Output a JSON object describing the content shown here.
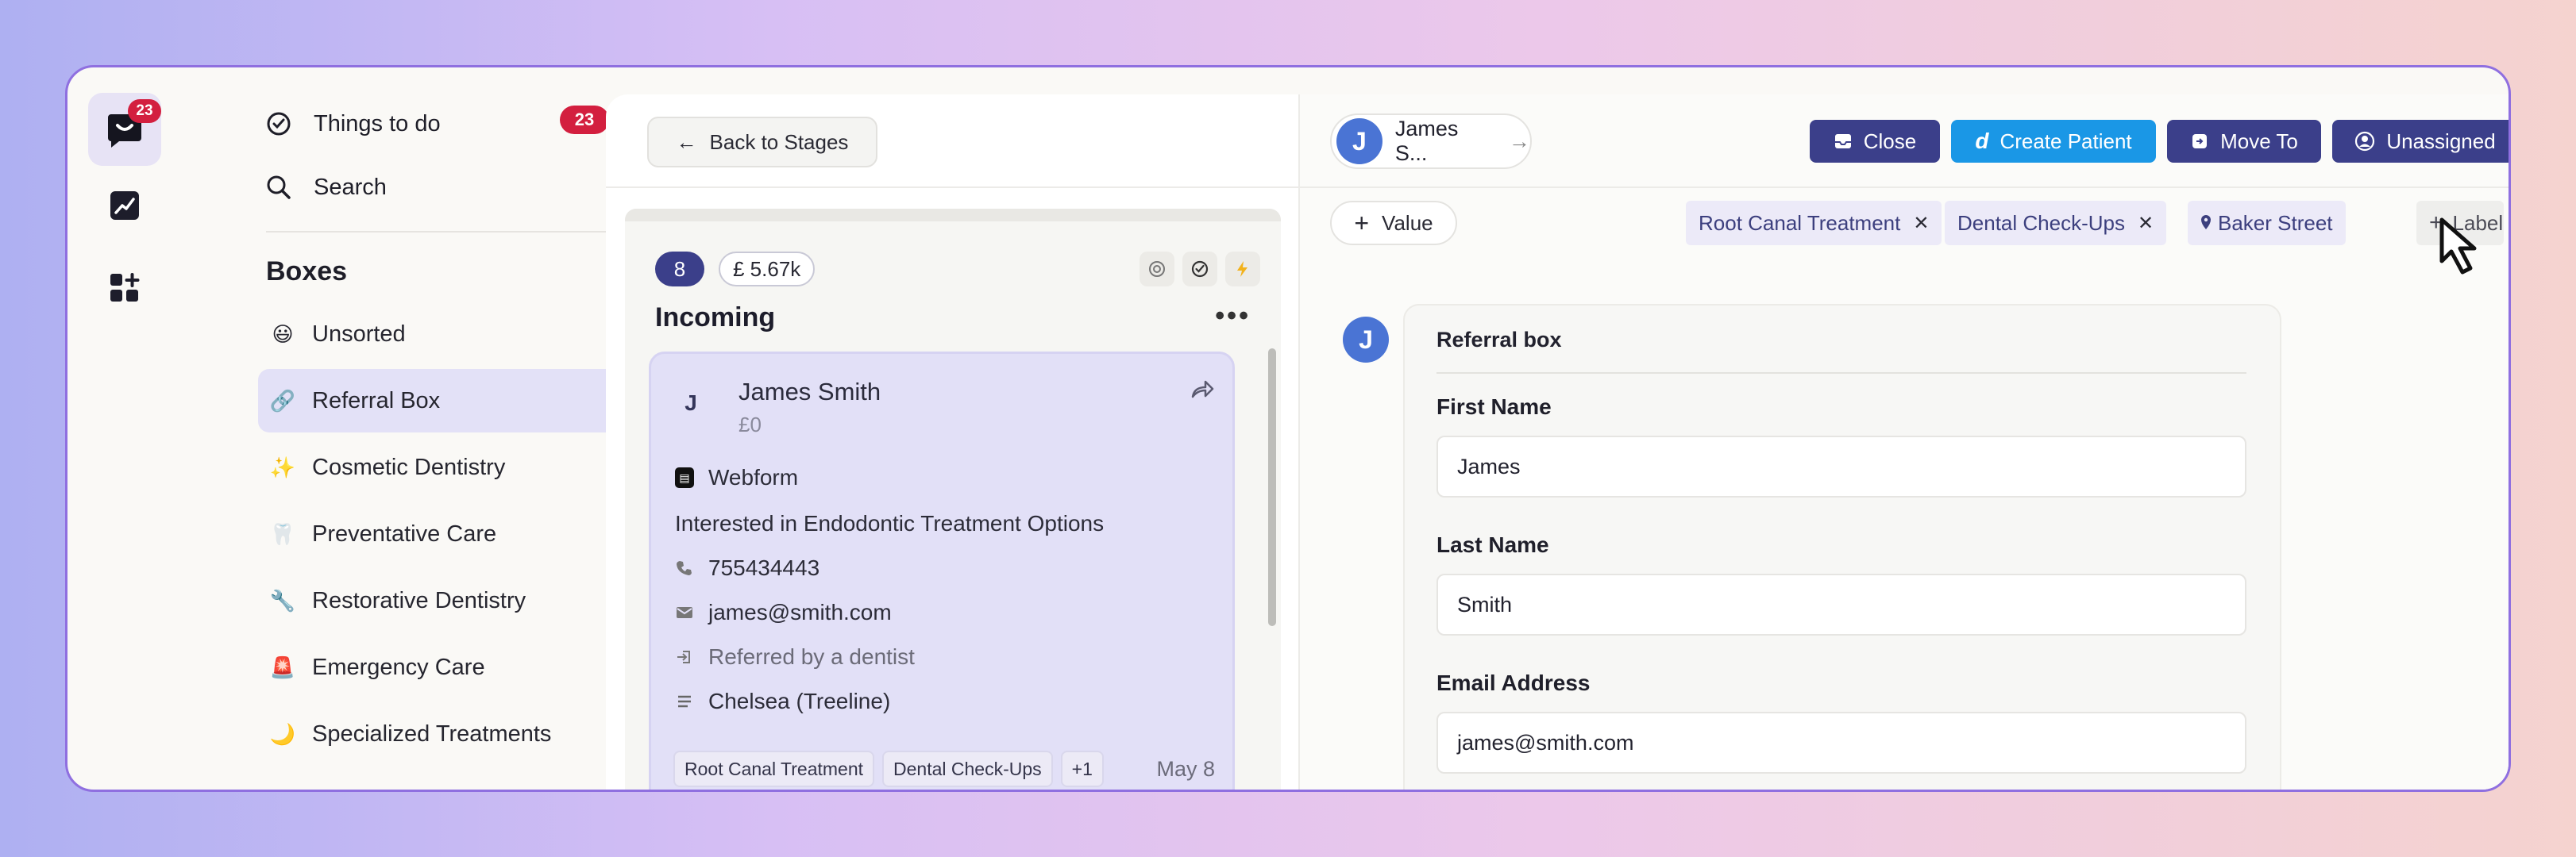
{
  "rail": {
    "logo_badge": "23"
  },
  "sidebar": {
    "things_to_do": "Things to do",
    "things_count": "23",
    "search": "Search",
    "boxes_heading": "Boxes",
    "boxes": [
      {
        "emoji": "😃",
        "label": "Unsorted"
      },
      {
        "emoji": "🔗",
        "label": "Referral Box"
      },
      {
        "emoji": "✨",
        "label": "Cosmetic Dentistry"
      },
      {
        "emoji": "🦷",
        "label": "Preventative Care"
      },
      {
        "emoji": "🔧",
        "label": "Restorative Dentistry"
      },
      {
        "emoji": "🚨",
        "label": "Emergency Care"
      },
      {
        "emoji": "🌙",
        "label": "Specialized Treatments"
      }
    ]
  },
  "middle": {
    "back_label": "Back to Stages",
    "stage": {
      "count": "8",
      "value": "£ 5.67k",
      "title": "Incoming",
      "more": "•••"
    },
    "lead": {
      "avatar": "J",
      "name": "James Smith",
      "amount": "£0",
      "source": "Webform",
      "interest": "Interested in Endodontic Treatment Options",
      "phone": "755434443",
      "email": "james@smith.com",
      "referral": "Referred by a dentist",
      "location": "Chelsea (Treeline)",
      "chips": [
        "Root Canal Treatment",
        "Dental Check-Ups",
        "+1"
      ],
      "date": "May 8"
    }
  },
  "right": {
    "contact": {
      "avatar": "J",
      "name": "James S...",
      "arrow": "→"
    },
    "actions": {
      "close": "Close",
      "create_patient": "Create Patient",
      "move_to": "Move To",
      "unassigned": "Unassigned"
    },
    "value_label": "Value",
    "tags": [
      "Root Canal Treatment",
      "Dental Check-Ups",
      "Baker Street"
    ],
    "label_btn": "Label",
    "form": {
      "avatar": "J",
      "title": "Referral box",
      "first_name_label": "First Name",
      "first_name_value": "James",
      "last_name_label": "Last Name",
      "last_name_value": "Smith",
      "email_label": "Email Address",
      "email_value": "james@smith.com"
    }
  },
  "colors": {
    "accent_dark": "#3b3f8a",
    "accent_blue": "#1a97e6",
    "badge_red": "#d31f3f",
    "avatar_blue": "#4a74d4"
  }
}
